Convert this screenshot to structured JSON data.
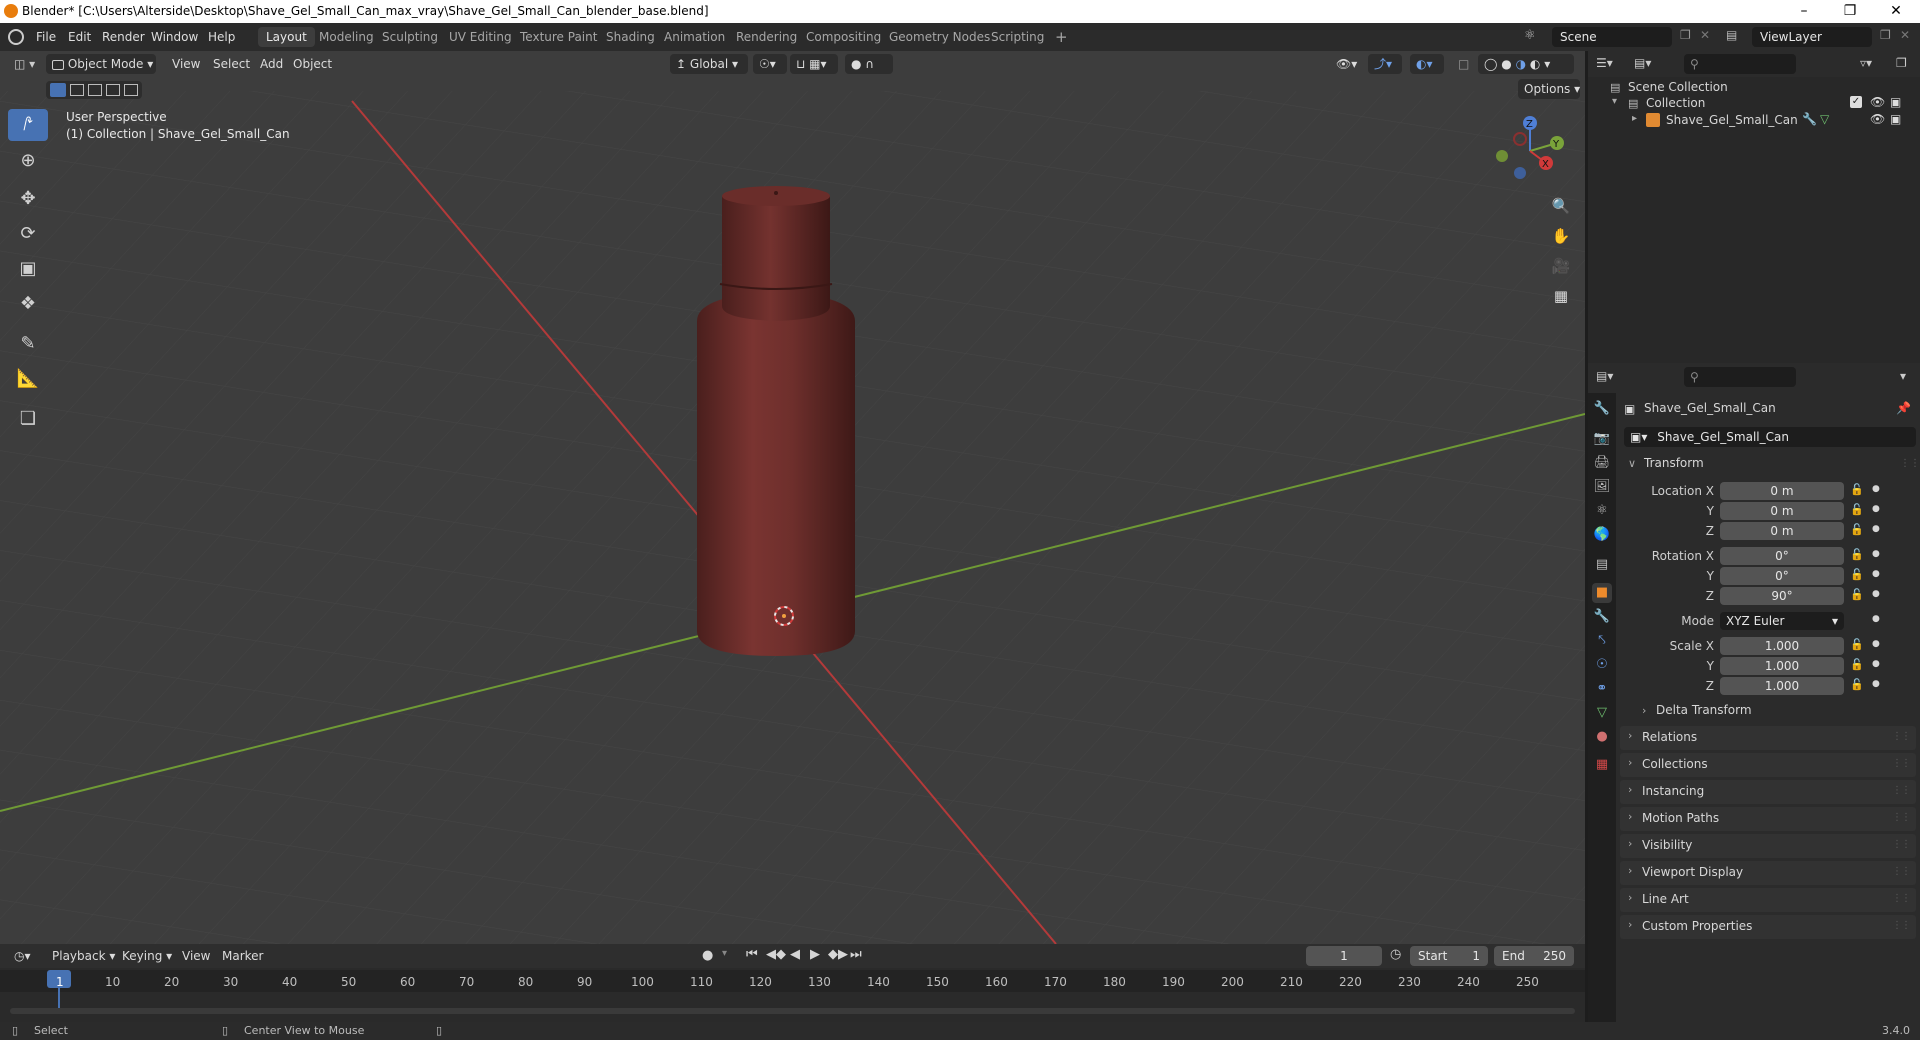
{
  "window": {
    "title": "Blender* [C:\\Users\\Alterside\\Desktop\\Shave_Gel_Small_Can_max_vray\\Shave_Gel_Small_Can_blender_base.blend]",
    "minimize": "–",
    "restore": "❐",
    "close": "✕"
  },
  "menu": [
    "File",
    "Edit",
    "Render",
    "Window",
    "Help"
  ],
  "workspaces": [
    "Layout",
    "Modeling",
    "Sculpting",
    "UV Editing",
    "Texture Paint",
    "Shading",
    "Animation",
    "Rendering",
    "Compositing",
    "Geometry Nodes",
    "Scripting"
  ],
  "workspace_add": "+",
  "scene": {
    "name": "Scene",
    "view_layer": "ViewLayer"
  },
  "viewport": {
    "mode": "Object Mode",
    "menus": [
      "View",
      "Select",
      "Add",
      "Object"
    ],
    "transform_orientation": "Global",
    "options": "Options",
    "perspective": "User Perspective",
    "collection_info": "(1) Collection | Shave_Gel_Small_Can",
    "object_color": "#6e2f2c",
    "x_axis_color": "#c43c3c",
    "y_axis_color": "#7aa33a",
    "gizmo": {
      "x": "X",
      "y": "Y",
      "z": "Z"
    }
  },
  "tools": [
    "select-box-icon",
    "cursor-icon",
    "move-icon",
    "rotate-icon",
    "scale-icon",
    "transform-icon",
    "annotate-icon",
    "measure-icon",
    "add-cube-icon"
  ],
  "outliner": {
    "scene_collection": "Scene Collection",
    "collection": "Collection",
    "object": "Shave_Gel_Small_Can"
  },
  "properties": {
    "object_name": "Shave_Gel_Small_Can",
    "object_field": "Shave_Gel_Small_Can",
    "transform_label": "Transform",
    "location": {
      "label": "Location X",
      "x": "0 m",
      "y": "0 m",
      "z": "0 m"
    },
    "rotation": {
      "label": "Rotation X",
      "x": "0°",
      "y": "0°",
      "z": "90°"
    },
    "mode_label": "Mode",
    "mode_value": "XYZ Euler",
    "scale": {
      "label": "Scale X",
      "x": "1.000",
      "y": "1.000",
      "z": "1.000"
    },
    "axis_y": "Y",
    "axis_z": "Z",
    "delta_transform": "Delta Transform",
    "panels": [
      "Relations",
      "Collections",
      "Instancing",
      "Motion Paths",
      "Visibility",
      "Viewport Display",
      "Line Art",
      "Custom Properties"
    ]
  },
  "timeline": {
    "menus": [
      "Playback",
      "Keying",
      "View",
      "Marker"
    ],
    "current_frame": "1",
    "start_label": "Start",
    "start": "1",
    "end_label": "End",
    "end": "250",
    "ticks": [
      "1",
      "10",
      "20",
      "30",
      "40",
      "50",
      "60",
      "70",
      "80",
      "90",
      "100",
      "110",
      "120",
      "130",
      "140",
      "150",
      "160",
      "170",
      "180",
      "190",
      "200",
      "210",
      "220",
      "230",
      "240",
      "250"
    ]
  },
  "status": {
    "left": "Select",
    "middle": "Center View to Mouse",
    "version": "3.4.0"
  }
}
